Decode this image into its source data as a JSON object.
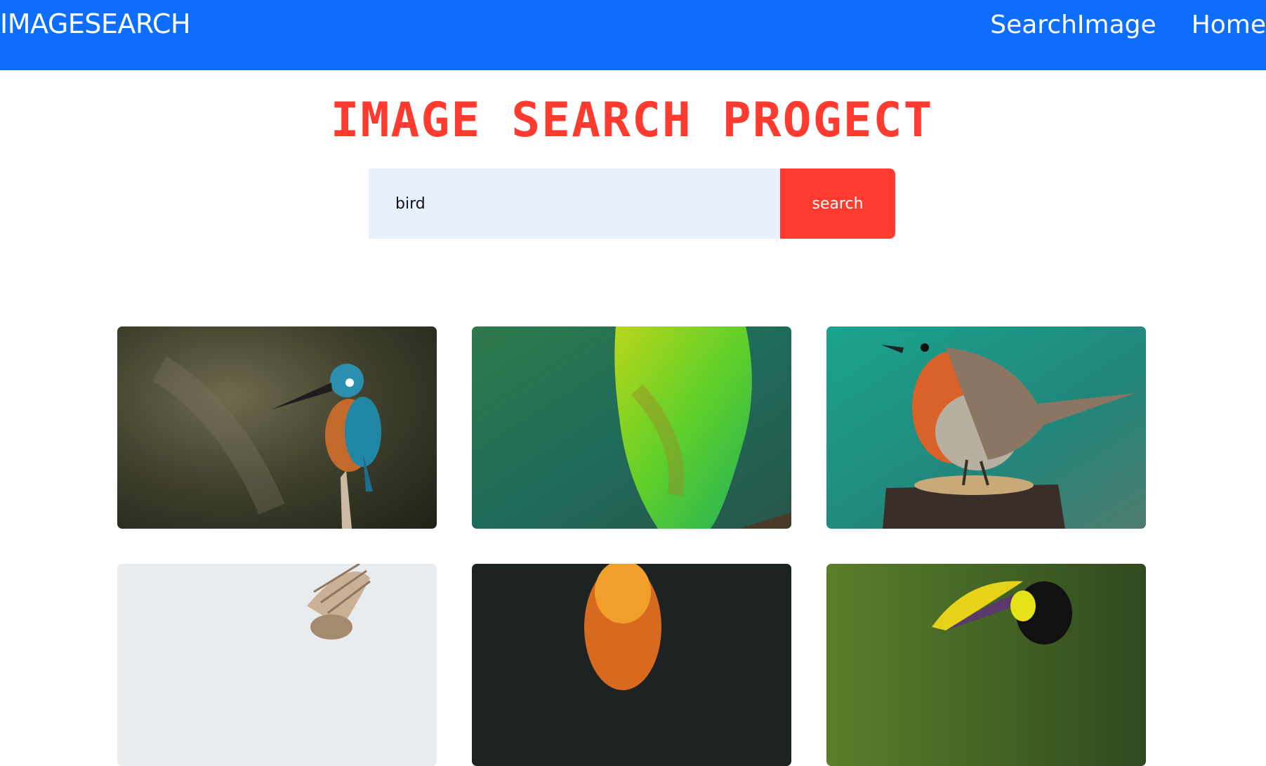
{
  "navbar": {
    "brand": "IMAGESEARCH",
    "links": [
      {
        "label": "SearchImage"
      },
      {
        "label": "Home"
      }
    ],
    "color": "#0d6efd"
  },
  "heading": {
    "title": "IMAGE SEARCH PROGECT",
    "color": "#ff3b2f"
  },
  "search": {
    "value": "bird",
    "button_label": "search",
    "input_bg": "#e8f0fe",
    "button_color": "#ff3b2f"
  },
  "results": [
    {
      "subject": "kingfisher-photo"
    },
    {
      "subject": "green-parrot-photo"
    },
    {
      "subject": "robin-photo"
    },
    {
      "subject": "bird-in-flight-photo"
    },
    {
      "subject": "orange-bird-photo"
    },
    {
      "subject": "toucan-photo"
    }
  ]
}
